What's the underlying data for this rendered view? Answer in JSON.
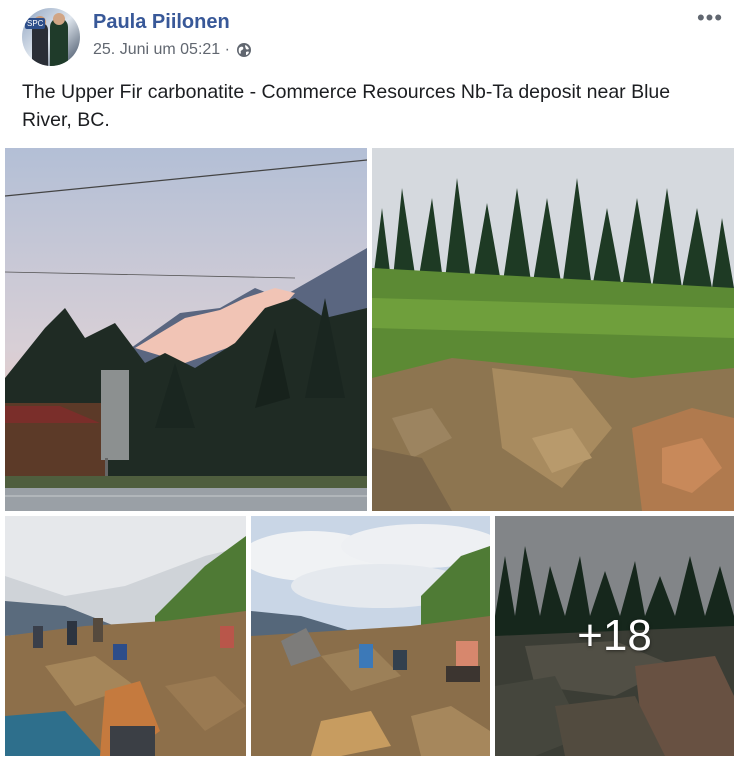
{
  "post": {
    "author": "Paula Piilonen",
    "timestamp": "25. Juni um 05:21 ·",
    "privacy_icon": "globe-icon",
    "options_icon": "more-horizontal-icon",
    "options_glyph": "•••",
    "avatar_badge": "SPC",
    "text": "The Upper Fir carbonatite - Commerce Resources Nb-Ta deposit near Blue River, BC."
  },
  "gallery": {
    "remaining_count": "+18"
  },
  "colors": {
    "author_link": "#385898",
    "meta_text": "#616770",
    "body_text": "#1c1e21"
  }
}
